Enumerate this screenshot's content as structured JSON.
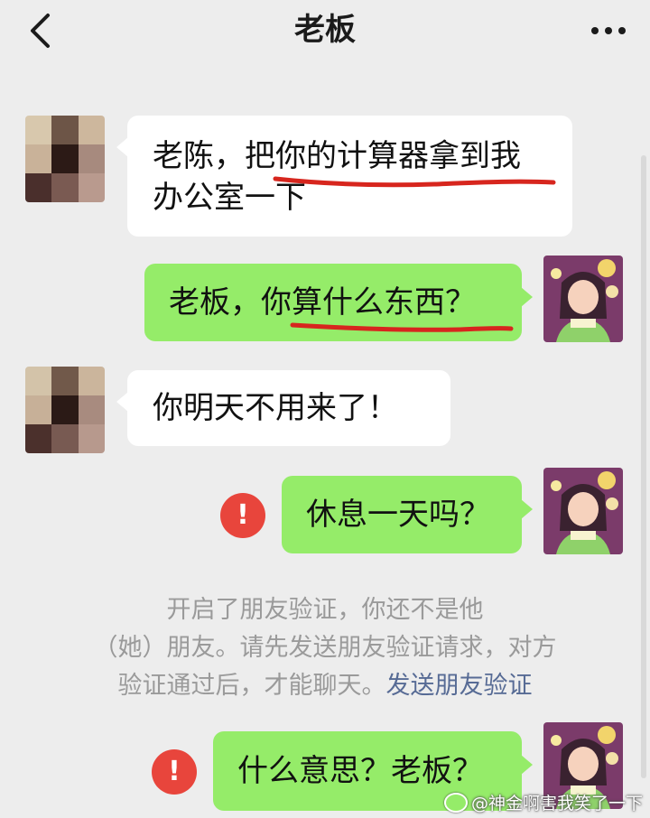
{
  "header": {
    "title": "老板",
    "back_icon": "chevron-left-icon",
    "more_icon": "ellipsis-icon"
  },
  "messages": [
    {
      "from": "boss",
      "lines": [
        "老陈，把你的计算器拿到我",
        "办公室一下"
      ]
    },
    {
      "from": "me",
      "lines": [
        "老板，你算什么东西？"
      ]
    },
    {
      "from": "boss",
      "lines": [
        "你明天不用来了！"
      ]
    },
    {
      "from": "me",
      "lines": [
        "休息一天吗？"
      ],
      "failed": true
    },
    {
      "from": "me",
      "lines": [
        "什么意思？老板？"
      ],
      "failed": true
    }
  ],
  "error_mark": "!",
  "notice": {
    "line1": "开启了朋友验证，你还不是他",
    "line2": "（她）朋友。请先发送朋友验证请求，对方",
    "line3": "验证通过后，才能聊天。",
    "link": "发送朋友验证"
  },
  "watermark": {
    "text": "@神金啊害我笑了一下"
  },
  "colors": {
    "background": "#ededed",
    "sent_bubble": "#95ec69",
    "received_bubble": "#ffffff",
    "error": "#e8453c",
    "link": "#576b95",
    "underline": "#d7261e"
  }
}
